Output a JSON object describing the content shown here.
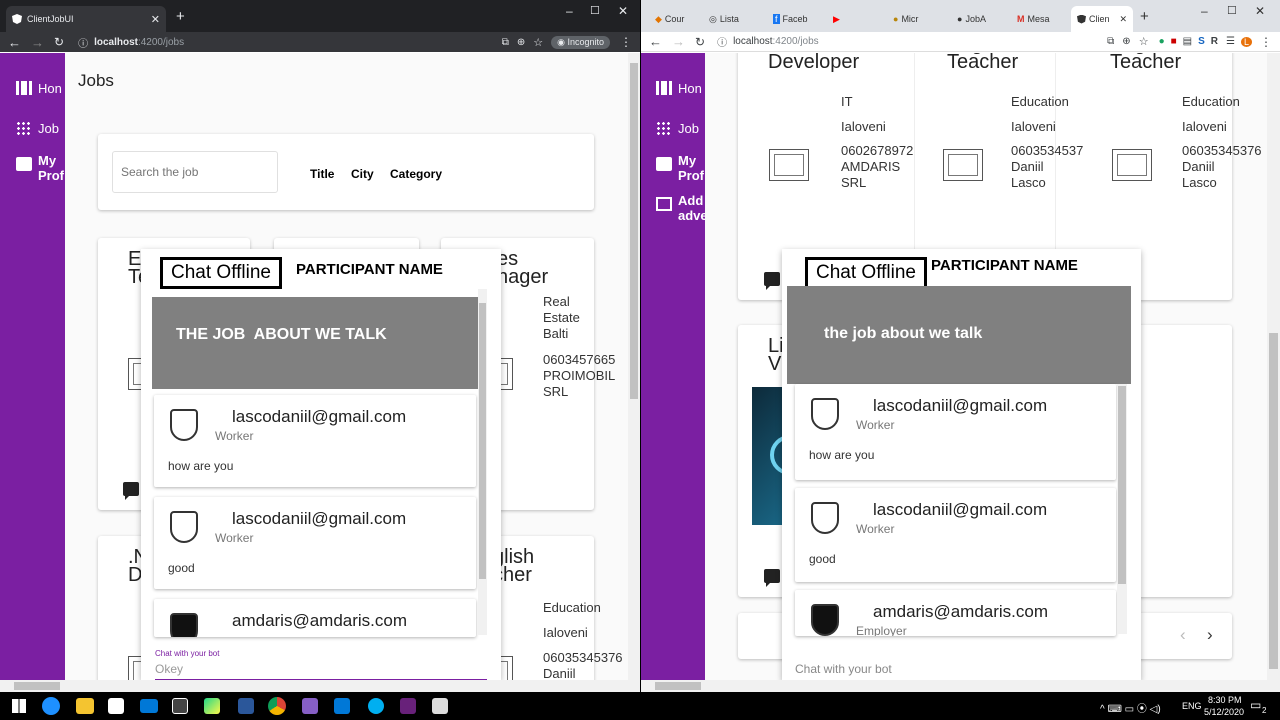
{
  "left": {
    "tab_title": "ClientJobUI",
    "url_host": "localhost",
    "url_path": ":4200/jobs",
    "incognito_label": "Incognito",
    "sidebar": {
      "home": "Hon",
      "jobs": "Job",
      "profile": "My\nProf"
    },
    "page_title": "Jobs",
    "search_placeholder": "Search the job",
    "filters": [
      "Title",
      "City",
      "Category"
    ],
    "cards": {
      "c1_title": "E\nTe",
      "c2_title": "es\nnager",
      "c2_lines": [
        "Real\nEstate\nBalti",
        "0603457665\nPROIMOBIL\nSRL"
      ],
      "c4_title": ".N\nD",
      "c5_title": "glish\ncher",
      "c5_lines": [
        "Education",
        "Ialoveni",
        "06035345376\nDaniil"
      ]
    },
    "chat": {
      "status": "Chat Offline",
      "participant": "PARTICIPANT NAME",
      "banner": "THE JOB  ABOUT WE TALK",
      "messages": [
        {
          "email": "lascodaniil@gmail.com",
          "role": "Worker",
          "text": "how are you"
        },
        {
          "email": "lascodaniil@gmail.com",
          "role": "Worker",
          "text": "good"
        },
        {
          "email": "amdaris@amdaris.com",
          "role": "",
          "text": ""
        }
      ],
      "input_label": "Chat with your bot",
      "input_value": "Okey"
    }
  },
  "right": {
    "tabs": [
      "Cour",
      "Lista",
      "Faceb",
      "",
      "Micr",
      "JobA",
      "Mesa",
      "Clien"
    ],
    "url_host": "localhost",
    "url_path": ":4200/jobs",
    "sidebar": {
      "home": "Hon",
      "jobs": "Job",
      "profile": "My\nProf",
      "add": "Add\nadve"
    },
    "cards": [
      {
        "title": ".NET\nDeveloper",
        "category": "IT",
        "city": "Ialoveni",
        "contact": "0602678972\nAMDARIS\nSRL"
      },
      {
        "title": "English\nTeacher",
        "category": "Education",
        "city": "Ialoveni",
        "contact": "0603534537\nDaniil\nLasco"
      },
      {
        "title": "English\nTeacher",
        "category": "Education",
        "city": "Ialoveni",
        "contact": "06035345376\nDaniil\nLasco"
      }
    ],
    "card4_title": "Li\nV",
    "chat": {
      "status": "Chat Offline",
      "participant": "PARTICIPANT NAME",
      "banner": "the job about we talk",
      "messages": [
        {
          "email": "lascodaniil@gmail.com",
          "role": "Worker",
          "text": "how are you"
        },
        {
          "email": "lascodaniil@gmail.com",
          "role": "Worker",
          "text": "good"
        },
        {
          "email": "amdaris@amdaris.com",
          "role": "Employer",
          "text": ""
        }
      ],
      "input_placeholder": "Chat with your bot"
    }
  },
  "taskbar": {
    "time": "8:30 PM",
    "date": "5/12/2020",
    "lang": "ENG",
    "notifications": "2"
  }
}
